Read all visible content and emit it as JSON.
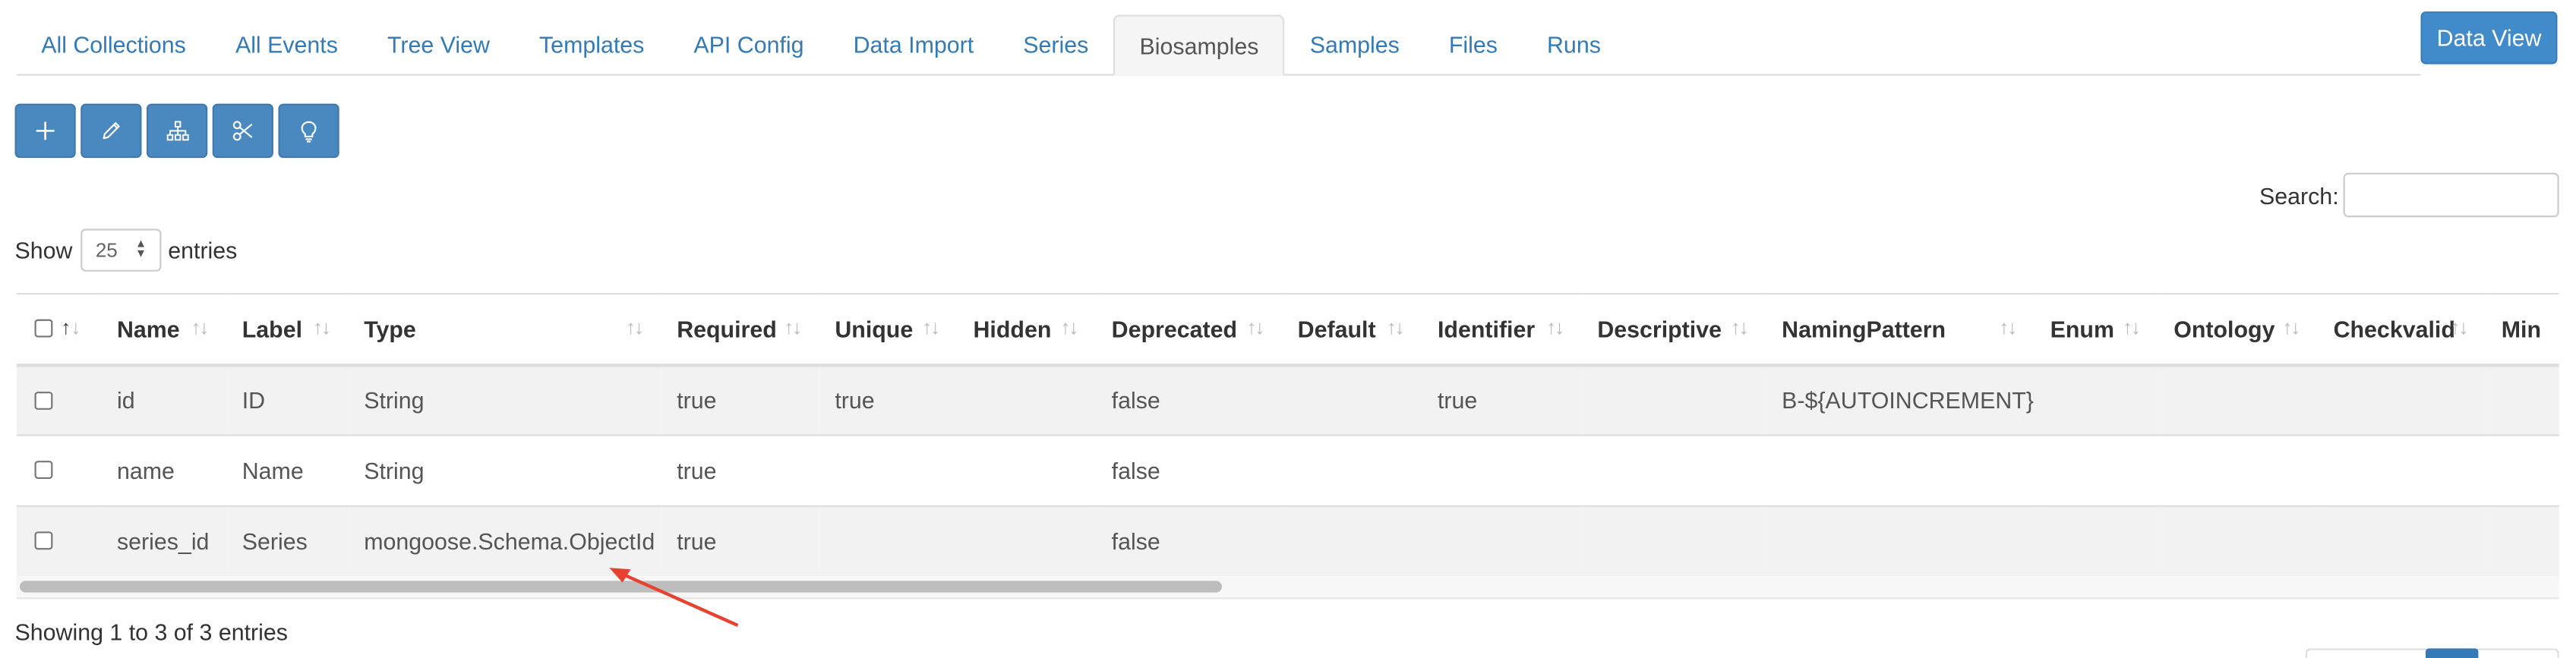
{
  "tabs": [
    {
      "label": "All Collections",
      "active": false
    },
    {
      "label": "All Events",
      "active": false
    },
    {
      "label": "Tree View",
      "active": false
    },
    {
      "label": "Templates",
      "active": false
    },
    {
      "label": "API Config",
      "active": false
    },
    {
      "label": "Data Import",
      "active": false
    },
    {
      "label": "Series",
      "active": false
    },
    {
      "label": "Biosamples",
      "active": true
    },
    {
      "label": "Samples",
      "active": false
    },
    {
      "label": "Files",
      "active": false
    },
    {
      "label": "Runs",
      "active": false
    }
  ],
  "header": {
    "data_view_label": "Data View"
  },
  "toolbar": {
    "buttons": [
      {
        "icon": "plus-icon"
      },
      {
        "icon": "pencil-icon"
      },
      {
        "icon": "sitemap-icon"
      },
      {
        "icon": "scissors-icon"
      },
      {
        "icon": "lightbulb-icon"
      }
    ]
  },
  "search": {
    "label": "Search:",
    "value": ""
  },
  "length": {
    "show_label": "Show",
    "entries_label": "entries",
    "selected": "25"
  },
  "table": {
    "columns": [
      "Name",
      "Label",
      "Type",
      "Required",
      "Unique",
      "Hidden",
      "Deprecated",
      "Default",
      "Identifier",
      "Descriptive",
      "NamingPattern",
      "Enum",
      "Ontology",
      "Checkvalid",
      "Min"
    ],
    "rows": [
      {
        "name": "id",
        "label": "ID",
        "type": "String",
        "required": "true",
        "unique": "true",
        "hidden": "",
        "deprecated": "false",
        "default": "",
        "identifier": "true",
        "descriptive": "",
        "naming_pattern": "B-${AUTOINCREMENT}",
        "enum": "",
        "ontology": "",
        "checkvalid": "",
        "min": ""
      },
      {
        "name": "name",
        "label": "Name",
        "type": "String",
        "required": "true",
        "unique": "",
        "hidden": "",
        "deprecated": "false",
        "default": "",
        "identifier": "",
        "descriptive": "",
        "naming_pattern": "",
        "enum": "",
        "ontology": "",
        "checkvalid": "",
        "min": ""
      },
      {
        "name": "series_id",
        "label": "Series",
        "type": "mongoose.Schema.ObjectId",
        "required": "true",
        "unique": "",
        "hidden": "",
        "deprecated": "false",
        "default": "",
        "identifier": "",
        "descriptive": "",
        "naming_pattern": "",
        "enum": "",
        "ontology": "",
        "checkvalid": "",
        "min": ""
      }
    ]
  },
  "info": {
    "text": "Showing 1 to 3 of 3 entries"
  },
  "colors": {
    "primary_button": "#4a88c0",
    "link": "#337ab7",
    "annotation_arrow": "#e8412f"
  }
}
